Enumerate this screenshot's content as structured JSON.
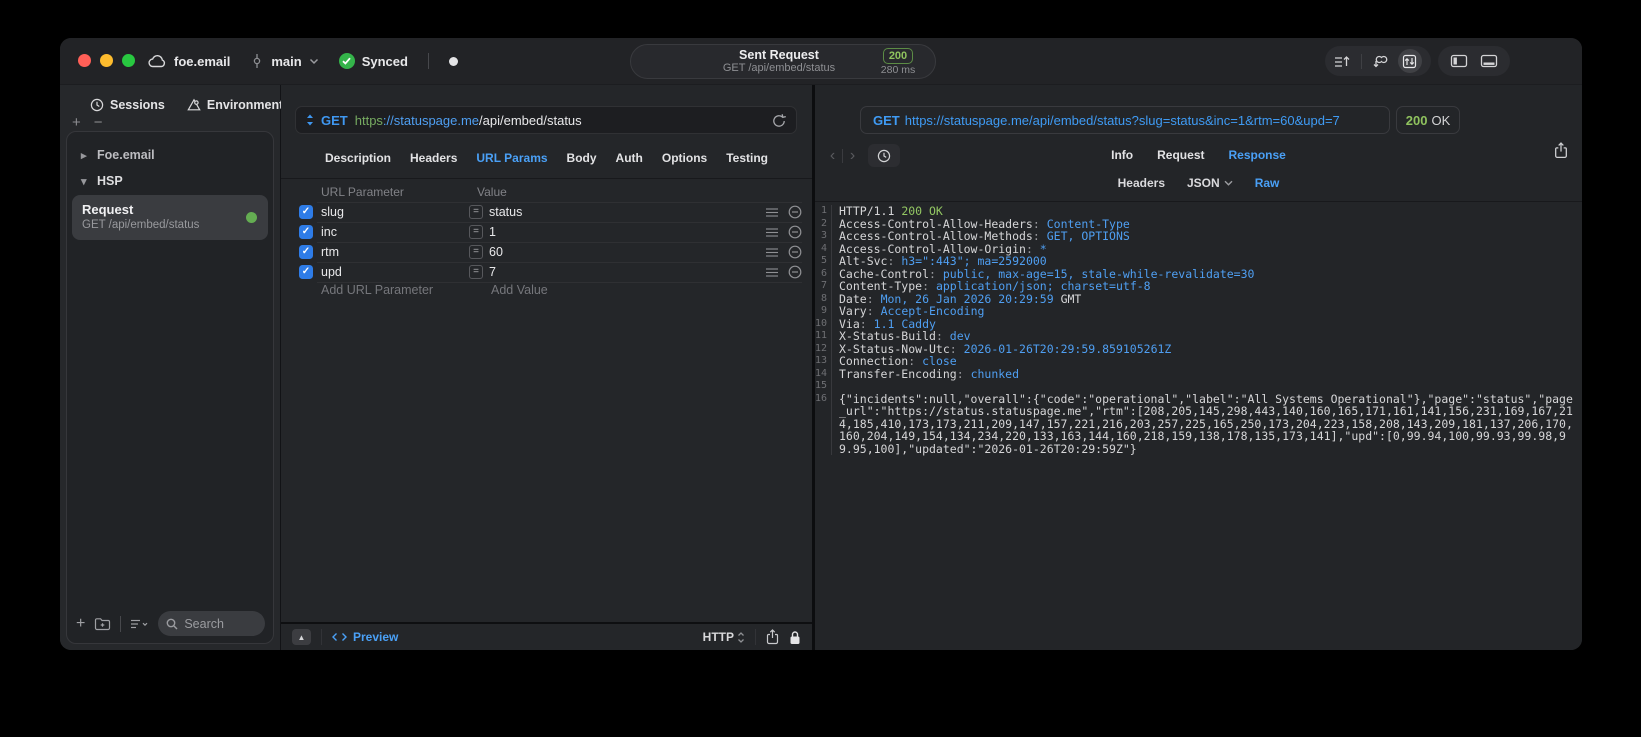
{
  "titlebar": {
    "project_name": "foe.email",
    "branch_name": "main",
    "sync_label": "Synced",
    "request_pill": {
      "title": "Sent Request",
      "subtitle": "GET /api/embed/status",
      "status_code": "200",
      "duration": "280 ms"
    }
  },
  "sidebar": {
    "tabs": [
      {
        "label": "Sessions",
        "icon": "clock-icon"
      },
      {
        "label": "Environments",
        "icon": "environments-icon"
      }
    ],
    "tree": {
      "group1": "Foe.email",
      "group2": "HSP"
    },
    "request_item": {
      "title": "Request",
      "subtitle": "GET /api/embed/status"
    },
    "search_placeholder": "Search"
  },
  "editor": {
    "method": "GET",
    "url": {
      "scheme": "https",
      "host": "://statuspage.me",
      "path": "/api/embed/status"
    },
    "tabs": [
      "Description",
      "Headers",
      "URL Params",
      "Body",
      "Auth",
      "Options",
      "Testing"
    ],
    "active_tab": "URL Params",
    "table": {
      "col_param": "URL Parameter",
      "col_value": "Value",
      "rows": [
        {
          "name": "slug",
          "value": "status",
          "checked": true
        },
        {
          "name": "inc",
          "value": "1",
          "checked": true
        },
        {
          "name": "rtm",
          "value": "60",
          "checked": true
        },
        {
          "name": "upd",
          "value": "7",
          "checked": true
        }
      ],
      "add_param": "Add URL Parameter",
      "add_value": "Add Value"
    },
    "footer": {
      "preview": "Preview",
      "protocol": "HTTP"
    }
  },
  "response": {
    "request_method": "GET",
    "request_url": "https://statuspage.me/api/embed/status?slug=status&inc=1&rtm=60&upd=7",
    "status_code": "200",
    "status_text": "OK",
    "tabs": [
      "Info",
      "Request",
      "Response"
    ],
    "active_tab": "Response",
    "subtabs": [
      "Headers",
      "JSON",
      "Raw"
    ],
    "active_subtab": "Raw",
    "lines": [
      {
        "n": "1",
        "parts": [
          [
            "HTTP/1.1 ",
            "w"
          ],
          [
            "200 OK",
            "g"
          ]
        ]
      },
      {
        "n": "2",
        "parts": [
          [
            "Access-Control-Allow-Headers",
            "w"
          ],
          [
            ": ",
            "d"
          ],
          [
            "Content-Type",
            "b"
          ]
        ]
      },
      {
        "n": "3",
        "parts": [
          [
            "Access-Control-Allow-Methods",
            "w"
          ],
          [
            ": ",
            "d"
          ],
          [
            "GET, OPTIONS",
            "b"
          ]
        ]
      },
      {
        "n": "4",
        "parts": [
          [
            "Access-Control-Allow-Origin",
            "w"
          ],
          [
            ": ",
            "d"
          ],
          [
            "*",
            "b"
          ]
        ]
      },
      {
        "n": "5",
        "parts": [
          [
            "Alt-Svc",
            "w"
          ],
          [
            ": ",
            "d"
          ],
          [
            "h3=\":443\"; ma=2592000",
            "b"
          ]
        ]
      },
      {
        "n": "6",
        "parts": [
          [
            "Cache-Control",
            "w"
          ],
          [
            ": ",
            "d"
          ],
          [
            "public, max-age=15, stale-while-revalidate=30",
            "b"
          ]
        ]
      },
      {
        "n": "7",
        "parts": [
          [
            "Content-Type",
            "w"
          ],
          [
            ": ",
            "d"
          ],
          [
            "application/json; charset=utf-8",
            "b"
          ]
        ]
      },
      {
        "n": "8",
        "parts": [
          [
            "Date",
            "w"
          ],
          [
            ": ",
            "d"
          ],
          [
            "Mon, 26 Jan 2026 20:29:59 ",
            "b"
          ],
          [
            "GMT",
            "w"
          ]
        ]
      },
      {
        "n": "9",
        "parts": [
          [
            "Vary",
            "w"
          ],
          [
            ": ",
            "d"
          ],
          [
            "Accept-Encoding",
            "b"
          ]
        ]
      },
      {
        "n": "10",
        "parts": [
          [
            "Via",
            "w"
          ],
          [
            ": ",
            "d"
          ],
          [
            "1.1 Caddy",
            "b"
          ]
        ]
      },
      {
        "n": "11",
        "parts": [
          [
            "X-Status-Build",
            "w"
          ],
          [
            ": ",
            "d"
          ],
          [
            "dev",
            "b"
          ]
        ]
      },
      {
        "n": "12",
        "parts": [
          [
            "X-Status-Now-Utc",
            "w"
          ],
          [
            ": ",
            "d"
          ],
          [
            "2026-01-26T20:29:59.859105261Z",
            "b"
          ]
        ]
      },
      {
        "n": "13",
        "parts": [
          [
            "Connection",
            "w"
          ],
          [
            ": ",
            "d"
          ],
          [
            "close",
            "b"
          ]
        ]
      },
      {
        "n": "14",
        "parts": [
          [
            "Transfer-Encoding",
            "w"
          ],
          [
            ": ",
            "d"
          ],
          [
            "chunked",
            "b"
          ]
        ]
      },
      {
        "n": "15",
        "parts": []
      },
      {
        "n": "16",
        "parts": [
          [
            "{\"incidents\":null,\"overall\":{\"code\":\"operational\",\"label\":\"All Systems Operational\"},\"page\":\"status\",\"page_url\":\"https://status.statuspage.me\",\"rtm\":[208,205,145,298,443,140,160,165,171,161,141,156,231,169,167,214,185,410,173,173,211,209,147,157,221,216,203,257,225,165,250,173,204,223,158,208,143,209,181,137,206,170,160,204,149,154,134,234,220,133,163,144,160,218,159,138,178,135,173,141],\"upd\":[0,99.94,100,99.93,99.98,99.95,100],\"updated\":\"2026-01-26T20:29:59Z\"}",
            "w"
          ]
        ]
      }
    ]
  },
  "colors": {
    "accent_blue": "#4aa0f6",
    "status_green": "#8fc25e",
    "checkbox_blue": "#2e7ce7",
    "window_bg": "#242629",
    "page_bg": "#000000"
  }
}
